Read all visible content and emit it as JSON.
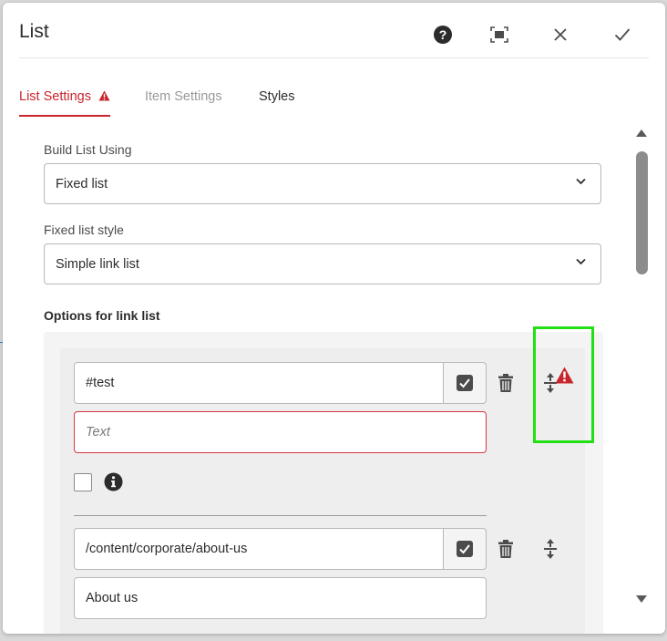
{
  "dialog": {
    "title": "List",
    "header_buttons": {
      "help_icon": "help-icon",
      "fullscreen_icon": "fullscreen-icon",
      "close_icon": "close-icon",
      "done_icon": "checkmark-icon"
    }
  },
  "tabs": [
    {
      "label": "List Settings",
      "state": "active",
      "warning": true
    },
    {
      "label": "Item Settings",
      "state": "inactive"
    },
    {
      "label": "Styles",
      "state": "enabled"
    }
  ],
  "form": {
    "build_list_label": "Build List Using",
    "build_list_value": "Fixed list",
    "list_style_label": "Fixed list style",
    "list_style_value": "Simple link list",
    "options_label": "Options for link list"
  },
  "items": [
    {
      "path": "#test",
      "text_placeholder": "Text",
      "text_value": "",
      "text_error": true
    },
    {
      "path": "/content/corporate/about-us",
      "text_value": "About us"
    }
  ],
  "colors": {
    "accent": "#c9252c",
    "error_border": "#d7373f",
    "highlight": "#22e014"
  }
}
